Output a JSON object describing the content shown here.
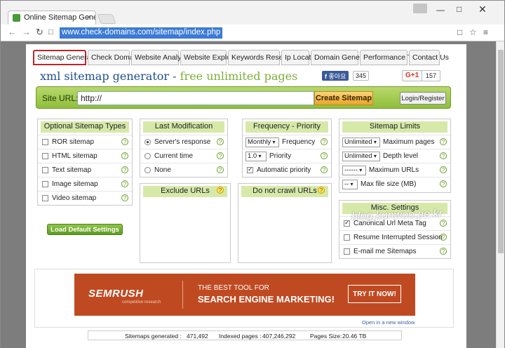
{
  "browser": {
    "tab_title": "Online Sitemap Generat",
    "url": "www.check-domains.com/sitemap/index.php"
  },
  "nav_tabs": [
    "Sitemap Generator",
    "Check Domains",
    "Website Analyzer",
    "Website Explorer",
    "Keywords Research",
    "Ip Locator",
    "Domain Generator",
    "Performance Test",
    "Contact Us"
  ],
  "heading": {
    "part1": "xml sitemap generator",
    "sep": " - ",
    "part2": "free unlimited pages"
  },
  "social": {
    "fb_label": "좋아요",
    "fb_count": "345",
    "gplus_label": "G+1",
    "gplus_count": "157"
  },
  "site_url": {
    "label": "Site URL:",
    "value": "http://",
    "create_label": "Create Sitemap",
    "login_label": "Login/Register"
  },
  "optional_types": {
    "title": "Optional Sitemap Types",
    "items": [
      "ROR sitemap",
      "HTML sitemap",
      "Text sitemap",
      "Image sitemap",
      "Video sitemap"
    ]
  },
  "last_modification": {
    "title": "Last Modification",
    "items": [
      "Server's response",
      "Current time",
      "None"
    ]
  },
  "frequency": {
    "title": "Frequency - Priority",
    "freq_value": "Monthly",
    "freq_label": "Frequency",
    "priority_value": "1.0",
    "priority_label": "Priority",
    "auto_label": "Automatic priority"
  },
  "limits": {
    "title": "Sitemap Limits",
    "max_pages_value": "Unlimited",
    "max_pages_label": "Maximum pages",
    "depth_value": "Unlimited",
    "depth_label": "Depth level",
    "max_urls_value": "------",
    "max_urls_label": "Maximum URLs",
    "max_size_value": "--",
    "max_size_label": "Max file size (MB)"
  },
  "exclude_urls": {
    "title": "Exclude URLs"
  },
  "no_crawl_urls": {
    "title": "Do not crawl URLs"
  },
  "misc": {
    "title": "Misc. Settings",
    "items": [
      "Canonical Url Meta Tag",
      "Resume Interrupted Session",
      "E-mail me Sitemaps"
    ]
  },
  "load_defaults": "Load Default Settings",
  "ad": {
    "brand": "SEMRUSH",
    "brand_sub": "competitive research",
    "line1": "THE BEST TOOL FOR",
    "line2": "SEARCH ENGINE MARKETING!",
    "cta": "TRY IT NOW!",
    "new_window": "Open in a new window"
  },
  "stats": {
    "generated_label": "Sitemaps generated :",
    "generated_value": "471,492",
    "indexed_label": "Indexed pages :",
    "indexed_value": "407,246,292",
    "size_label": "Pages Size:",
    "size_value": "20.46 TB"
  },
  "watermark": "blog.kunwoo.pe.kr"
}
